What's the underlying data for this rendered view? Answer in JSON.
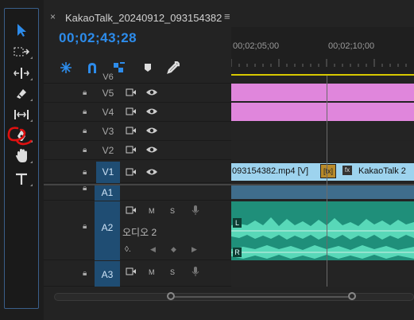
{
  "sequence": {
    "tab_title": "KakaoTalk_20240912_093154382",
    "close_glyph": "×",
    "menu_glyph": "≡",
    "timecode": "00;02;43;28"
  },
  "ruler": {
    "labels": [
      "00;02;05;00",
      "00;02;10;00"
    ]
  },
  "tracks": {
    "video": [
      {
        "name": "V6"
      },
      {
        "name": "V5"
      },
      {
        "name": "V4"
      },
      {
        "name": "V3"
      },
      {
        "name": "V2"
      },
      {
        "name": "V1"
      }
    ],
    "audio": [
      {
        "name": "A1"
      },
      {
        "name": "A2",
        "channel_name": "오디오 2",
        "m": "M",
        "s": "S"
      },
      {
        "name": "A3",
        "m": "M",
        "s": "S"
      }
    ]
  },
  "clips": {
    "v1_clip_text": "093154382.mp4 [V]",
    "fx_badge": "fx",
    "v1_next_clip": "KakaoTalk  2",
    "audio_left_label": "L",
    "audio_right_label": "R"
  },
  "icons": {
    "toolbar": [
      "selection-icon",
      "track-select-icon",
      "ripple-edit-icon",
      "razor-icon",
      "slip-icon",
      "pen-icon",
      "hand-icon",
      "type-icon"
    ],
    "header": [
      "snap-icon",
      "linked-selection-icon",
      "add-marker-icon",
      "marker-icon",
      "settings-wrench-icon"
    ]
  },
  "colors": {
    "accent_blue": "#2d8ceb",
    "clip_pink": "#e086dc",
    "clip_video": "#9dd3ee",
    "clip_audio": "#1f8f7a",
    "playhead_yellow": "#d7c800",
    "annotation_red": "#e01010"
  }
}
